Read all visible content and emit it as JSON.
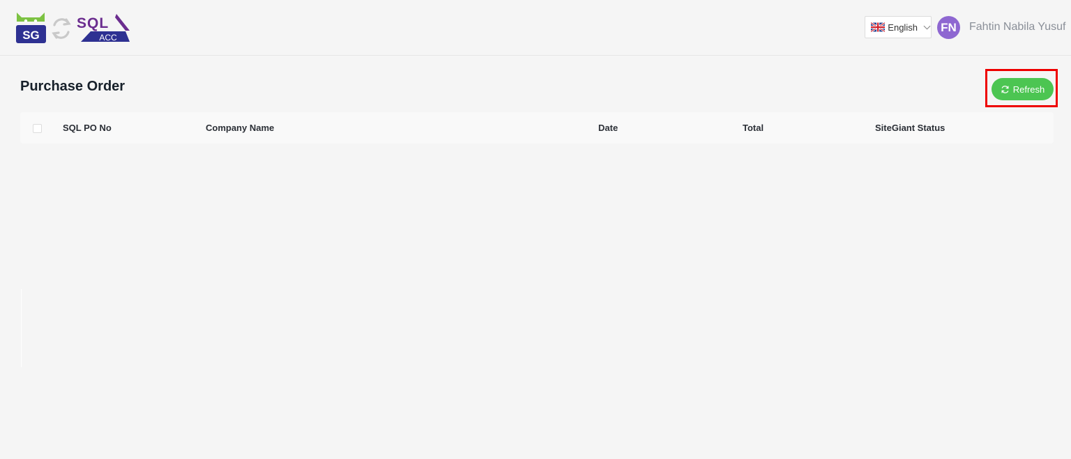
{
  "header": {
    "logo": {
      "sg_text": "SG",
      "sql_text": "SQL",
      "acc_text": "ACC",
      "icons": [
        "sg-robot-logo-icon",
        "sync-arrows-icon",
        "sql-acc-logo-icon"
      ]
    },
    "language": {
      "selected": "English",
      "flag_icon": "uk-flag-icon",
      "chevron_icon": "chevron-down-icon"
    },
    "user": {
      "initials": "FN",
      "name": "Fahtin Nabila Yusuf"
    }
  },
  "main": {
    "title": "Purchase Order",
    "refresh_label": "Refresh",
    "refresh_icon": "refresh-icon",
    "table": {
      "columns": [
        "SQL PO No",
        "Company Name",
        "Date",
        "Total",
        "SiteGiant Status"
      ],
      "rows": []
    }
  },
  "colors": {
    "accent_green": "#4cc552",
    "highlight_red": "#ee0000",
    "avatar_purple": "#8e67d1",
    "brand_purple": "#6b2d8f",
    "brand_green": "#7cc242",
    "brand_navy": "#2e3192",
    "page_background": "#f5f5f5"
  }
}
